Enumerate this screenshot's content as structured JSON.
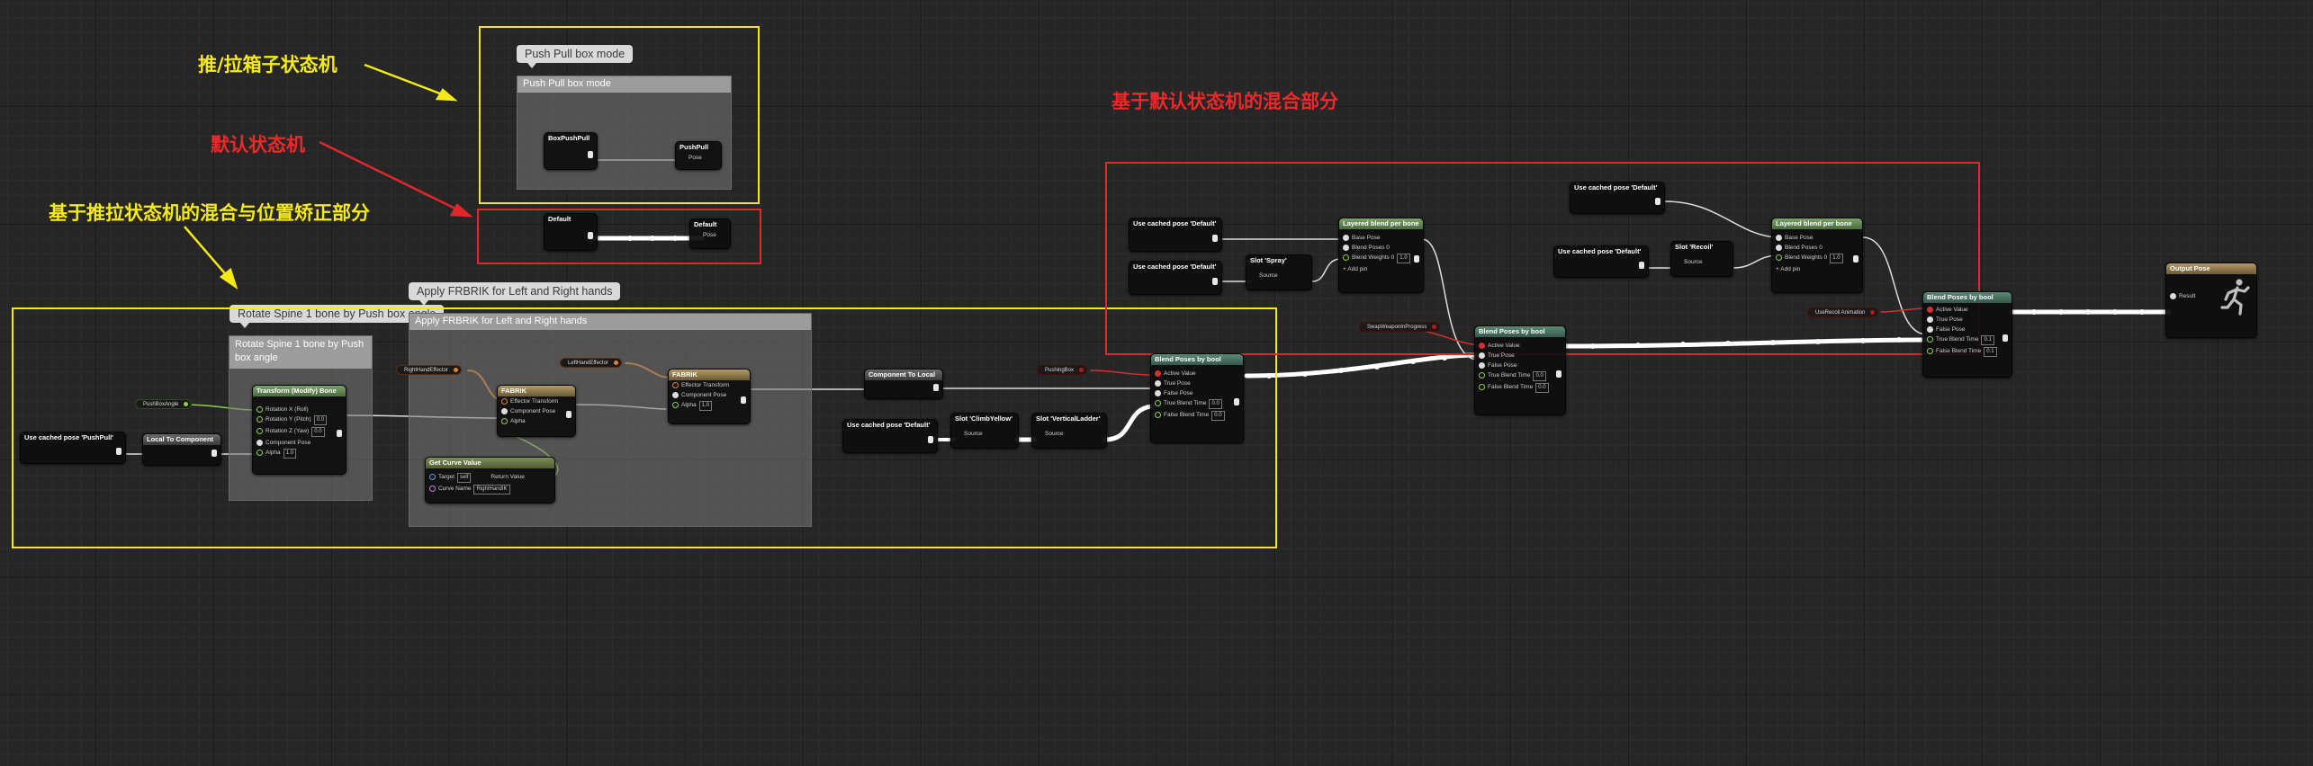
{
  "annotations": {
    "push_pull_sm": "推/拉箱子状态机",
    "default_sm": "默认状态机",
    "push_blend_correction": "基于推拉状态机的混合与位置矫正部分",
    "default_blend": "基于默认状态机的混合部分"
  },
  "colors": {
    "frame_yellow": "#f5ea16",
    "frame_red": "#e0282a"
  },
  "comments": {
    "push_pull_bubble": "Push Pull box mode",
    "push_pull_title": "Push Pull box mode",
    "rotate_bubble": "Rotate Spine 1 bone by Push box angle",
    "rotate_title": "Rotate Spine 1 bone by Push box angle",
    "fabrik_bubble": "Apply FRBRIK for Left and Right hands",
    "fabrik_title": "Apply FRBRIK for Left and Right hands"
  },
  "nodes": {
    "box_push_pull": {
      "title": "BoxPushPull"
    },
    "push_pull": {
      "title": "PushPull",
      "pin": "Pose"
    },
    "default_sm": {
      "title": "Default"
    },
    "default_out": {
      "title": "Default",
      "pin": "Pose"
    },
    "cached_pushpull": {
      "title": "Use cached pose 'PushPull'"
    },
    "local_to_component": {
      "title": "Local To Component"
    },
    "push_box_angle": {
      "title": "PushBoxAngle"
    },
    "transform_bone": {
      "title": "Transform (Modify) Bone",
      "pins": [
        "Rotation X (Roll)",
        "Rotation Y (Pitch)",
        "Rotation Z (Yaw)",
        "Component Pose",
        "Alpha"
      ],
      "values": [
        "0.0",
        "0.0",
        "1.0"
      ]
    },
    "right_hand_effector": {
      "title": "RightHandEffector"
    },
    "left_hand_effector": {
      "title": "LeftHandEffector"
    },
    "fabrik_1": {
      "title": "FABRIK",
      "pins": [
        "Effector Transform",
        "Component Pose",
        "Alpha"
      ]
    },
    "fabrik_2": {
      "title": "FABRIK",
      "pins": [
        "Effector Transform",
        "Component Pose",
        "Alpha"
      ],
      "alpha": "1.0"
    },
    "get_curve_value": {
      "title": "Get Curve Value",
      "pins": [
        "Target",
        "Curve Name"
      ],
      "target": "self",
      "curve": "RightHandIK",
      "return": "Return Value"
    },
    "component_to_local": {
      "title": "Component To Local"
    },
    "cached_default_left": {
      "title": "Use cached pose 'Default'"
    },
    "slot_climb": {
      "title": "Slot 'ClimbYellow'",
      "pin": "Source"
    },
    "slot_vertical": {
      "title": "Slot 'VerticalLadder'",
      "pin": "Source"
    },
    "pushing_box": {
      "title": "PushingBox"
    },
    "blend_bool_1": {
      "title": "Blend Poses by bool",
      "pins": [
        "Active Value",
        "True Pose",
        "False Pose",
        "True Blend Time",
        "False Blend Time"
      ],
      "values": [
        "0.0",
        "0.0"
      ]
    },
    "cached_default_1": {
      "title": "Use cached pose 'Default'"
    },
    "cached_default_2": {
      "title": "Use cached pose 'Default'"
    },
    "slot_spray": {
      "title": "Slot 'Spray'",
      "pin": "Source"
    },
    "layered_1": {
      "title": "Layered blend per bone",
      "pins": [
        "Base Pose",
        "Blend Poses 0",
        "Blend Weights 0",
        "Add pin"
      ],
      "value": "1.0"
    },
    "swap_weapon": {
      "title": "SwapWeaponInProgress"
    },
    "blend_bool_2": {
      "title": "Blend Poses by bool",
      "pins": [
        "Active Value",
        "True Pose",
        "False Pose",
        "True Blend Time",
        "False Blend Time"
      ],
      "values": [
        "0.0",
        "0.0"
      ]
    },
    "cached_default_3": {
      "title": "Use cached pose 'Default'"
    },
    "cached_default_4": {
      "title": "Use cached pose 'Default'"
    },
    "slot_recoil": {
      "title": "Slot 'Recoil'",
      "pin": "Source"
    },
    "layered_2": {
      "title": "Layered blend per bone",
      "pins": [
        "Base Pose",
        "Blend Poses 0",
        "Blend Weights 0",
        "Add pin"
      ],
      "value": "1.0"
    },
    "use_recoil": {
      "title": "UseRecoil Animation"
    },
    "blend_bool_3": {
      "title": "Blend Poses by bool",
      "pins": [
        "Active Value",
        "True Pose",
        "False Pose",
        "True Blend Time",
        "False Blend Time"
      ],
      "values": [
        "0.1",
        "0.1"
      ]
    },
    "output_pose": {
      "title": "Output Pose",
      "pin": "Result"
    }
  }
}
